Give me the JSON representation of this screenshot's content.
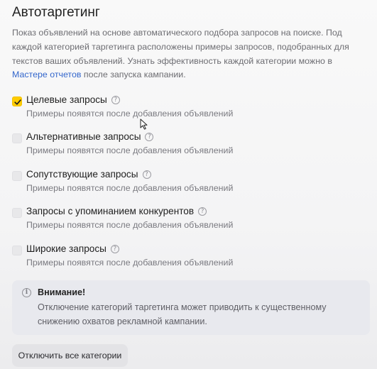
{
  "section": {
    "title": "Автотаргетинг",
    "description_text": "Показ объявлений на основе автоматического подбора запросов на поиске. Под каждой категорией таргетинга расположены примеры запросов, подобранных для текстов ваших объявлений. Узнать эффективность каждой категории можно в ",
    "report_link_label": "Мастере отчетов",
    "description_tail": " после запуска кампании."
  },
  "categories": [
    {
      "label": "Целевые запросы",
      "checked": true,
      "hint": "Примеры появятся после добавления объявлений"
    },
    {
      "label": "Альтернативные запросы",
      "checked": false,
      "hint": "Примеры появятся после добавления объявлений"
    },
    {
      "label": "Сопутствующие запросы",
      "checked": false,
      "hint": "Примеры появятся после добавления объявлений"
    },
    {
      "label": "Запросы с упоминанием конкурентов",
      "checked": false,
      "hint": "Примеры появятся после добавления объявлений"
    },
    {
      "label": "Широкие запросы",
      "checked": false,
      "hint": "Примеры появятся после добавления объявлений"
    }
  ],
  "warning": {
    "title": "Внимание!",
    "text": "Отключение категорий таргетинга может приводить к существенному снижению охватов рекламной кампании.",
    "icon": "info-icon"
  },
  "disable_all_button": "Отключить все категории",
  "help_icon_glyph": "?",
  "info_icon_glyph": "i",
  "colors": {
    "checkbox_checked": "#ffcc00",
    "link": "#3366cc"
  }
}
